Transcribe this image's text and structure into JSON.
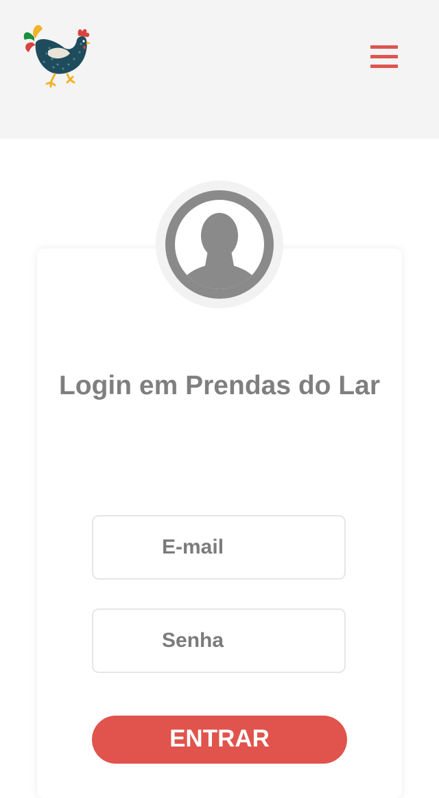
{
  "header": {
    "logo_icon": "rooster-logo-icon",
    "menu_icon": "hamburger-menu-icon",
    "background_color": "#f4f4f4"
  },
  "login": {
    "avatar_icon": "user-avatar-icon",
    "title": "Login em Prendas do Lar",
    "email_placeholder": "E-mail",
    "password_placeholder": "Senha",
    "submit_label": "ENTRAR"
  },
  "colors": {
    "accent": "#e0544d",
    "title_text": "#7f7f7f",
    "avatar_gray": "#8a8a8a"
  }
}
